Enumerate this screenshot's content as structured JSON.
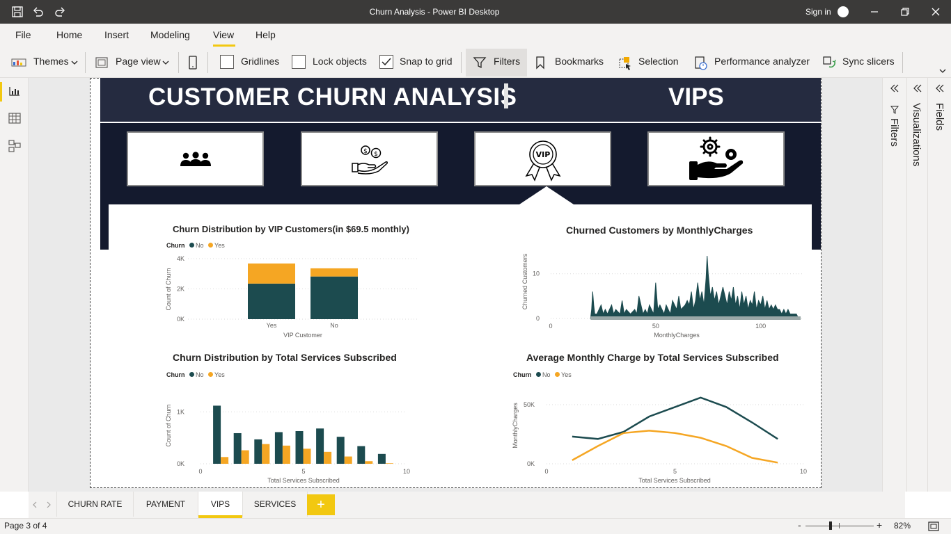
{
  "app": {
    "window_title": "Churn Analysis - Power BI Desktop",
    "sign_in": "Sign in"
  },
  "menu": [
    "File",
    "Home",
    "Insert",
    "Modeling",
    "View",
    "Help"
  ],
  "ribbon": {
    "themes": "Themes",
    "page_view": "Page view",
    "gridlines": "Gridlines",
    "lock_objects": "Lock objects",
    "snap_to_grid": "Snap to grid",
    "filters": "Filters",
    "bookmarks": "Bookmarks",
    "selection": "Selection",
    "performance_analyzer": "Performance analyzer",
    "sync_slicers": "Sync slicers"
  },
  "panes": {
    "filters": "Filters",
    "visualizations": "Visualizations",
    "fields": "Fields"
  },
  "report": {
    "title": "CUSTOMER CHURN ANALYSIS",
    "section": "VIPS"
  },
  "legend": {
    "title": "Churn",
    "no": "No",
    "yes": "Yes",
    "color_no": "#1c4b4f",
    "color_yes": "#f5a623"
  },
  "charts": {
    "vip": {
      "title": "Churn Distribution by VIP Customers(in $69.5 monthly)",
      "chart_data": {
        "type": "bar",
        "stacked": true,
        "categories": [
          "Yes",
          "No"
        ],
        "series": [
          {
            "name": "No",
            "values": [
              2350,
              2820
            ]
          },
          {
            "name": "Yes",
            "values": [
              1330,
              540
            ]
          }
        ],
        "xlabel": "VIP Customer",
        "ylabel": "Count of Churn",
        "yticks": [
          "0K",
          "2K",
          "4K"
        ],
        "ylim": [
          0,
          4000
        ]
      }
    },
    "monthly": {
      "title": "Churned Customers by MonthlyCharges",
      "chart_data": {
        "type": "area",
        "xlabel": "MonthlyCharges",
        "ylabel": "Churned Customers",
        "xticks": [
          "0",
          "50",
          "100"
        ],
        "yticks": [
          "0",
          "10"
        ],
        "xlim": [
          0,
          120
        ],
        "ylim": [
          0,
          14
        ],
        "x": [
          19,
          19.5,
          20,
          20.5,
          21,
          22,
          24,
          25,
          26,
          27,
          29,
          30,
          31,
          33,
          34,
          35,
          36,
          38,
          40,
          41,
          42,
          44,
          45,
          46,
          47,
          49,
          50,
          51,
          52,
          54,
          55,
          56,
          57,
          58,
          60,
          61,
          62,
          64,
          65,
          66,
          67,
          68,
          69,
          70,
          71,
          72,
          73,
          74,
          74.5,
          75,
          76,
          77,
          78,
          79,
          80,
          81,
          82,
          84,
          85,
          86,
          87,
          88,
          89,
          90,
          91,
          92,
          93,
          94,
          95,
          96,
          97,
          98,
          99,
          100,
          101,
          102,
          103,
          104,
          105,
          106,
          107,
          108,
          109,
          110,
          111,
          112,
          113,
          114,
          115,
          116,
          117,
          118,
          119
        ],
        "y": [
          0,
          2,
          6,
          3,
          1,
          1,
          3,
          1,
          2,
          1,
          3,
          1,
          2,
          1,
          4,
          1,
          2,
          1,
          2,
          1,
          5,
          1,
          2,
          1,
          3,
          1,
          8,
          2,
          3,
          1,
          3,
          2,
          1,
          4,
          2,
          5,
          2,
          3,
          4,
          3,
          6,
          2,
          4,
          8,
          4,
          6,
          3,
          9,
          14,
          10,
          5,
          7,
          4,
          6,
          3,
          5,
          7,
          3,
          6,
          4,
          7,
          3,
          5,
          2,
          6,
          3,
          5,
          2,
          4,
          3,
          6,
          2,
          4,
          3,
          5,
          2,
          4,
          2,
          3,
          2,
          3,
          2,
          2,
          1,
          2,
          1,
          2,
          1,
          1,
          1,
          1,
          0,
          0
        ]
      }
    },
    "services": {
      "title": "Churn Distribution by Total Services Subscribed",
      "chart_data": {
        "type": "bar",
        "categories": [
          1,
          2,
          3,
          4,
          5,
          6,
          7,
          8,
          9,
          10
        ],
        "series": [
          {
            "name": "No",
            "values": [
              1120,
              590,
              470,
              610,
              630,
              680,
              520,
              340,
              190,
              0
            ]
          },
          {
            "name": "Yes",
            "values": [
              130,
              260,
              380,
              350,
              290,
              230,
              140,
              50,
              10,
              0
            ]
          }
        ],
        "xlabel": "Total Services Subscribed",
        "ylabel": "Count of Churn",
        "xticks": [
          "0",
          "5",
          "10"
        ],
        "yticks": [
          "0K",
          "1K"
        ],
        "xlim": [
          0,
          10
        ],
        "ylim": [
          0,
          1300
        ]
      }
    },
    "avgcharge": {
      "title": "Average Monthly Charge by Total Services Subscribed",
      "chart_data": {
        "type": "line",
        "x": [
          1,
          2,
          3,
          4,
          5,
          6,
          7,
          8,
          9
        ],
        "series": [
          {
            "name": "No",
            "values": [
              23000,
              21000,
              27000,
              40000,
              48000,
              56000,
              48000,
              35000,
              21000
            ]
          },
          {
            "name": "Yes",
            "values": [
              3000,
              15000,
              26000,
              28000,
              26000,
              22000,
              15000,
              5000,
              1000
            ]
          }
        ],
        "xlabel": "Total Services Subscribed",
        "ylabel": "MonthlyCharges",
        "xticks": [
          "0",
          "5",
          "10"
        ],
        "yticks": [
          "0K",
          "50K"
        ],
        "xlim": [
          0,
          10
        ],
        "ylim": [
          0,
          60000
        ]
      }
    }
  },
  "tabs": [
    {
      "label": "CHURN RATE",
      "active": false
    },
    {
      "label": "PAYMENT",
      "active": false
    },
    {
      "label": "VIPS",
      "active": true
    },
    {
      "label": "SERVICES",
      "active": false
    }
  ],
  "add_tab": "+",
  "status": {
    "page": "Page 3 of 4",
    "zoom_minus": "-",
    "zoom_plus": "+",
    "zoom": "82%"
  }
}
